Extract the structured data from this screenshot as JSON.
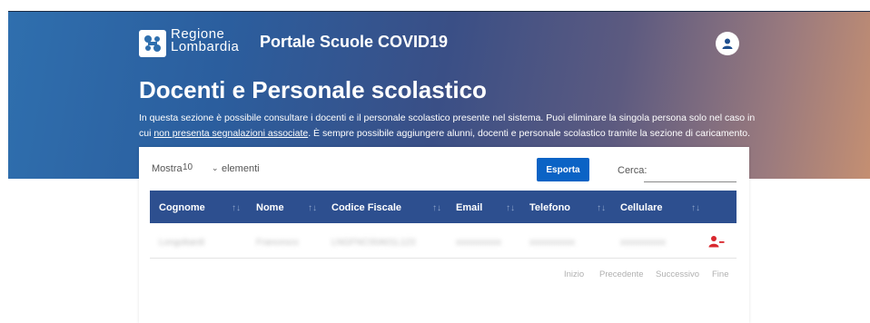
{
  "header": {
    "brand_line1": "Regione",
    "brand_line2": "Lombardia",
    "portal_title": "Portale Scuole COVID19"
  },
  "page": {
    "title": "Docenti e Personale scolastico",
    "desc_part1": "In questa sezione è possibile consultare i docenti e il personale scolastico presente nel sistema. Puoi eliminare la singola persona solo nel caso in cui ",
    "desc_link": "non presenta segnalazioni associate",
    "desc_part2": ". È sempre possibile aggiungere alunni, docenti e personale scolastico tramite la sezione di caricamento."
  },
  "controls": {
    "show_label": "Mostra",
    "page_size": "10",
    "elements_label": "elementi",
    "export_label": "Esporta",
    "search_label": "Cerca:",
    "search_value": ""
  },
  "table": {
    "columns": [
      "Cognome",
      "Nome",
      "Codice Fiscale",
      "Email",
      "Telefono",
      "Cellulare"
    ],
    "sort_glyph": "↑↓",
    "rows": [
      [
        "Longobardi",
        "Francesco",
        "LNGFNC00A01L123",
        "xxxxxxxxxx",
        "xxxxxxxxxx",
        "xxxxxxxxxx"
      ]
    ]
  },
  "pagination": {
    "first": "Inizio",
    "prev": "Precedente",
    "next": "Successivo",
    "last": "Fine"
  },
  "colors": {
    "header_row": "#2d4f8f",
    "primary_button": "#0b63c5",
    "delete_icon": "#d9272e"
  }
}
